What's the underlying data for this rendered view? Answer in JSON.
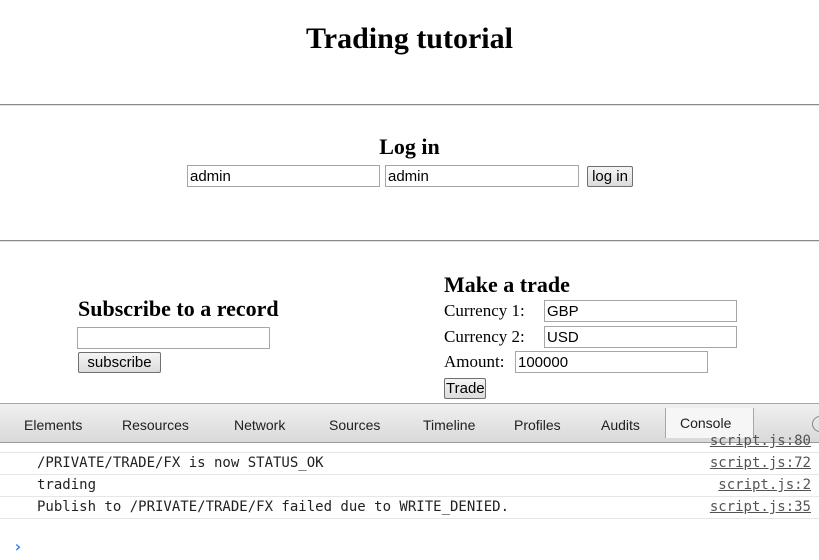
{
  "page": {
    "title": "Trading tutorial",
    "login": {
      "heading": "Log in",
      "username_value": "admin",
      "password_value": "admin",
      "button_label": "log in"
    },
    "subscribe": {
      "heading": "Subscribe to a record",
      "input_value": "",
      "button_label": "subscribe"
    },
    "trade": {
      "heading": "Make a trade",
      "currency1_label": "Currency 1:",
      "currency1_value": "GBP",
      "currency2_label": "Currency 2:",
      "currency2_value": "USD",
      "amount_label": "Amount:",
      "amount_value": "100000",
      "button_label": "Trade"
    }
  },
  "devtools": {
    "tabs": [
      "Elements",
      "Resources",
      "Network",
      "Sources",
      "Timeline",
      "Profiles",
      "Audits",
      "Console"
    ],
    "active_tab": "Console",
    "console": [
      {
        "message": "",
        "source": "script.js:80"
      },
      {
        "message": "/PRIVATE/TRADE/FX is now STATUS_OK",
        "source": "script.js:72"
      },
      {
        "message": "trading",
        "source": "script.js:2"
      },
      {
        "message": "Publish to /PRIVATE/TRADE/FX failed due to WRITE_DENIED.",
        "source": "script.js:35"
      }
    ],
    "prompt_symbol": "›",
    "colors": {
      "prompt": "#2f7ee5"
    }
  }
}
